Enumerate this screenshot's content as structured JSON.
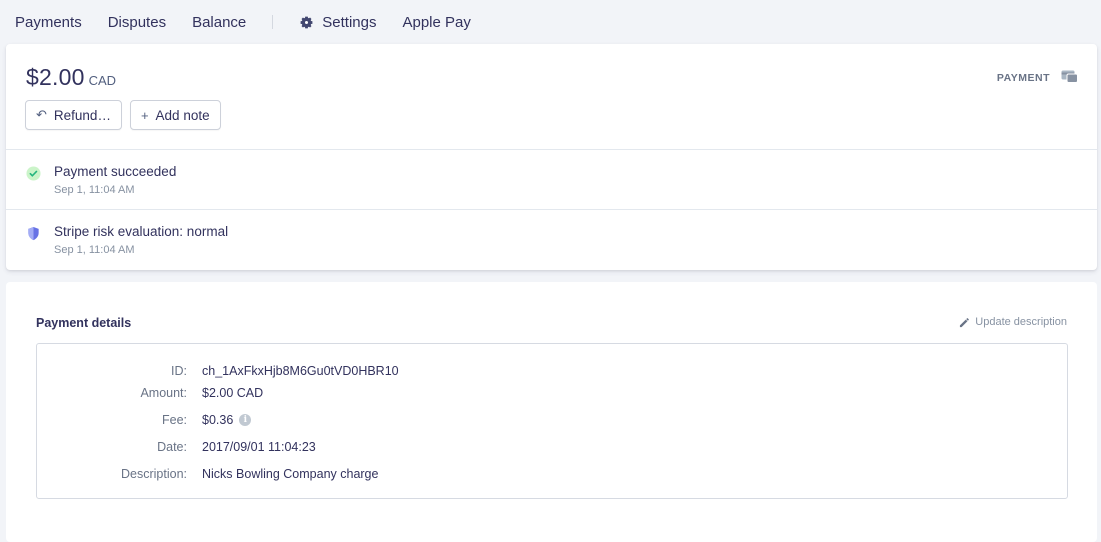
{
  "nav": {
    "items": [
      {
        "label": "Payments"
      },
      {
        "label": "Disputes"
      },
      {
        "label": "Balance"
      },
      {
        "label": "Settings"
      },
      {
        "label": "Apple Pay"
      }
    ]
  },
  "summary": {
    "amount": "$2.00",
    "currency": "CAD",
    "type_label": "PAYMENT",
    "refund_label": "Refund…",
    "add_note_label": "Add note"
  },
  "events": [
    {
      "title": "Payment succeeded",
      "time": "Sep 1, 11:04 AM",
      "icon": "check-circle-icon",
      "color": "#24b47e"
    },
    {
      "title": "Stripe risk evaluation: normal",
      "time": "Sep 1, 11:04 AM",
      "icon": "shield-icon",
      "color": "#6772e5"
    }
  ],
  "details": {
    "title": "Payment details",
    "update_label": "Update description",
    "rows": [
      {
        "key": "ID:",
        "value": "ch_1AxFkxHjb8M6Gu0tVD0HBR10"
      },
      {
        "key": "Amount:",
        "value": "$2.00 CAD"
      },
      {
        "key": "Fee:",
        "value": "$0.36"
      },
      {
        "key": "Date:",
        "value": "2017/09/01 11:04:23"
      },
      {
        "key": "Description:",
        "value": "Nicks Bowling Company charge"
      }
    ]
  }
}
